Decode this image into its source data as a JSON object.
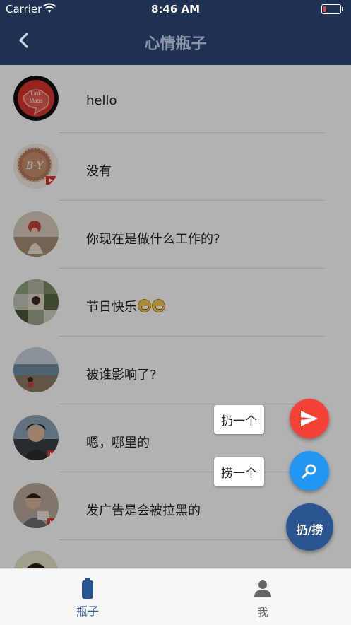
{
  "status_bar": {
    "carrier": "Carrier",
    "time": "8:46 AM",
    "battery_level": 0.15,
    "wifi_icon": "wifi-icon",
    "battery_icon": "battery-icon"
  },
  "nav": {
    "title": "心情瓶子",
    "back_icon": "chevron-left-icon"
  },
  "messages": [
    {
      "text": "hello",
      "avatar_icon": "avatar-linkmass-icon"
    },
    {
      "text": "没有",
      "avatar_icon": "avatar-by-seal-icon"
    },
    {
      "text": "你现在是做什么工作的?",
      "avatar_icon": "avatar-photo-icon"
    },
    {
      "text": "节日快乐",
      "emojis": [
        "grinning-face-emoji",
        "grinning-face-emoji"
      ],
      "avatar_icon": "avatar-photo-icon"
    },
    {
      "text": "被谁影响了?",
      "avatar_icon": "avatar-photo-icon"
    },
    {
      "text": "嗯，哪里的",
      "avatar_icon": "avatar-photo-icon"
    },
    {
      "text": "发广告是会被拉黑的",
      "avatar_icon": "avatar-photo-icon"
    },
    {
      "text": "",
      "avatar_icon": "avatar-photo-icon"
    }
  ],
  "fab": {
    "throw_label": "扔一个",
    "throw_icon": "send-icon",
    "throw_color": "#f44336",
    "fish_label": "捞一个",
    "fish_icon": "search-icon",
    "fish_color": "#2196f3",
    "main_label": "扔/捞",
    "main_color": "#2b5590"
  },
  "tabs": [
    {
      "label": "瓶子",
      "icon": "bottle-icon",
      "active": true
    },
    {
      "label": "我",
      "icon": "person-icon",
      "active": false
    }
  ],
  "colors": {
    "nav_background": "#1e3152",
    "active_tab": "#2b5590",
    "inactive_tab": "#666666"
  }
}
